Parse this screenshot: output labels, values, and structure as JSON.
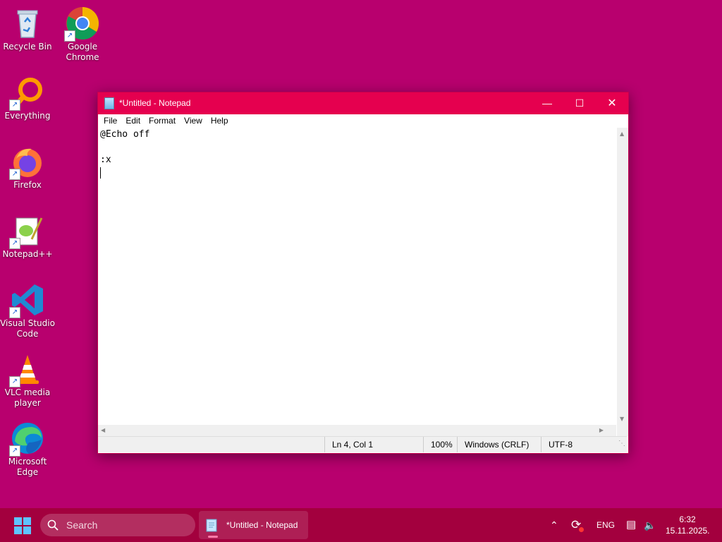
{
  "desktop": {
    "icons": [
      {
        "label": "Recycle Bin"
      },
      {
        "label": "Google Chrome"
      },
      {
        "label": "Everything"
      },
      {
        "label": "Firefox"
      },
      {
        "label": "Notepad++"
      },
      {
        "label": "Visual Studio Code"
      },
      {
        "label": "VLC media player"
      },
      {
        "label": "Microsoft Edge"
      }
    ]
  },
  "notepad": {
    "title": "*Untitled - Notepad",
    "menu": [
      "File",
      "Edit",
      "Format",
      "View",
      "Help"
    ],
    "lines": [
      "@Echo off",
      "",
      ":x",
      ""
    ],
    "status": {
      "position": "Ln 4, Col 1",
      "zoom": "100%",
      "line_ending": "Windows (CRLF)",
      "encoding": "UTF-8"
    }
  },
  "taskbar": {
    "search_placeholder": "Search",
    "active_app": "*Untitled - Notepad",
    "language": "ENG",
    "time": "6:32",
    "date": "15.11.2025."
  },
  "colors": {
    "desktop": "#b8006e",
    "titlebar": "#e5004f",
    "taskbar": "#a3003e"
  }
}
